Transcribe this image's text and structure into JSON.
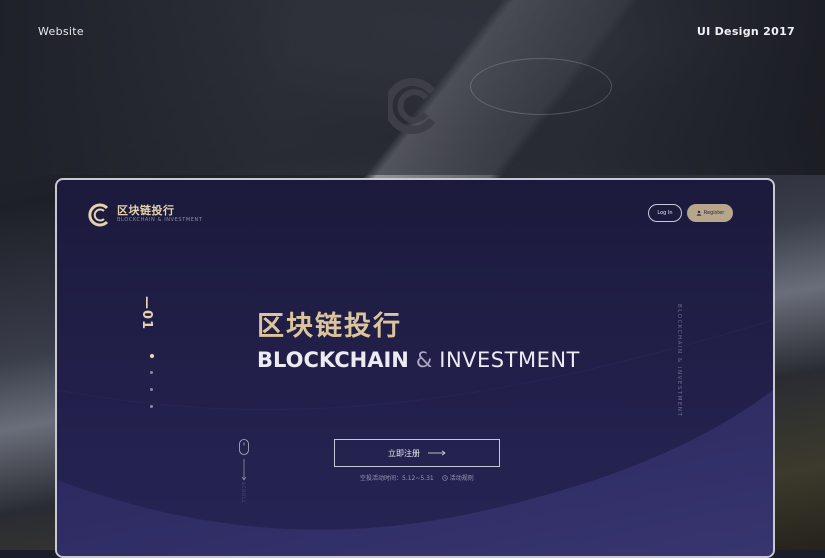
{
  "page": {
    "top_left_label": "Website",
    "top_right_label": "UI Design 2017"
  },
  "site": {
    "brand_name": "区块链投行",
    "brand_sub": "BLOCKCHAIN & INVESTMENT",
    "nav": {
      "login_label": "Log In",
      "register_label": "Register"
    },
    "hero": {
      "slide_index": "—01",
      "title_cn": "区块链投行",
      "title_en_bold": "BLOCKCHAIN",
      "title_en_amp": "&",
      "title_en_light": "INVESTMENT",
      "side_text": "BLOCKCHAIN  &  INVESTMENT",
      "cta_label": "立即注册",
      "note_period": "空投活动时间：5.12~5.31",
      "note_rules": "活动规则",
      "scroll_label": "SCROLL"
    },
    "pager": {
      "count": 4,
      "active": 1
    }
  },
  "colors": {
    "gold": "#dcc59b",
    "navy": "#1f1d44",
    "button_gold": "#b7a68a"
  },
  "icons": [
    "brand-logo-icon",
    "user-icon",
    "arrow-right-icon",
    "mouse-icon",
    "clock-icon"
  ]
}
